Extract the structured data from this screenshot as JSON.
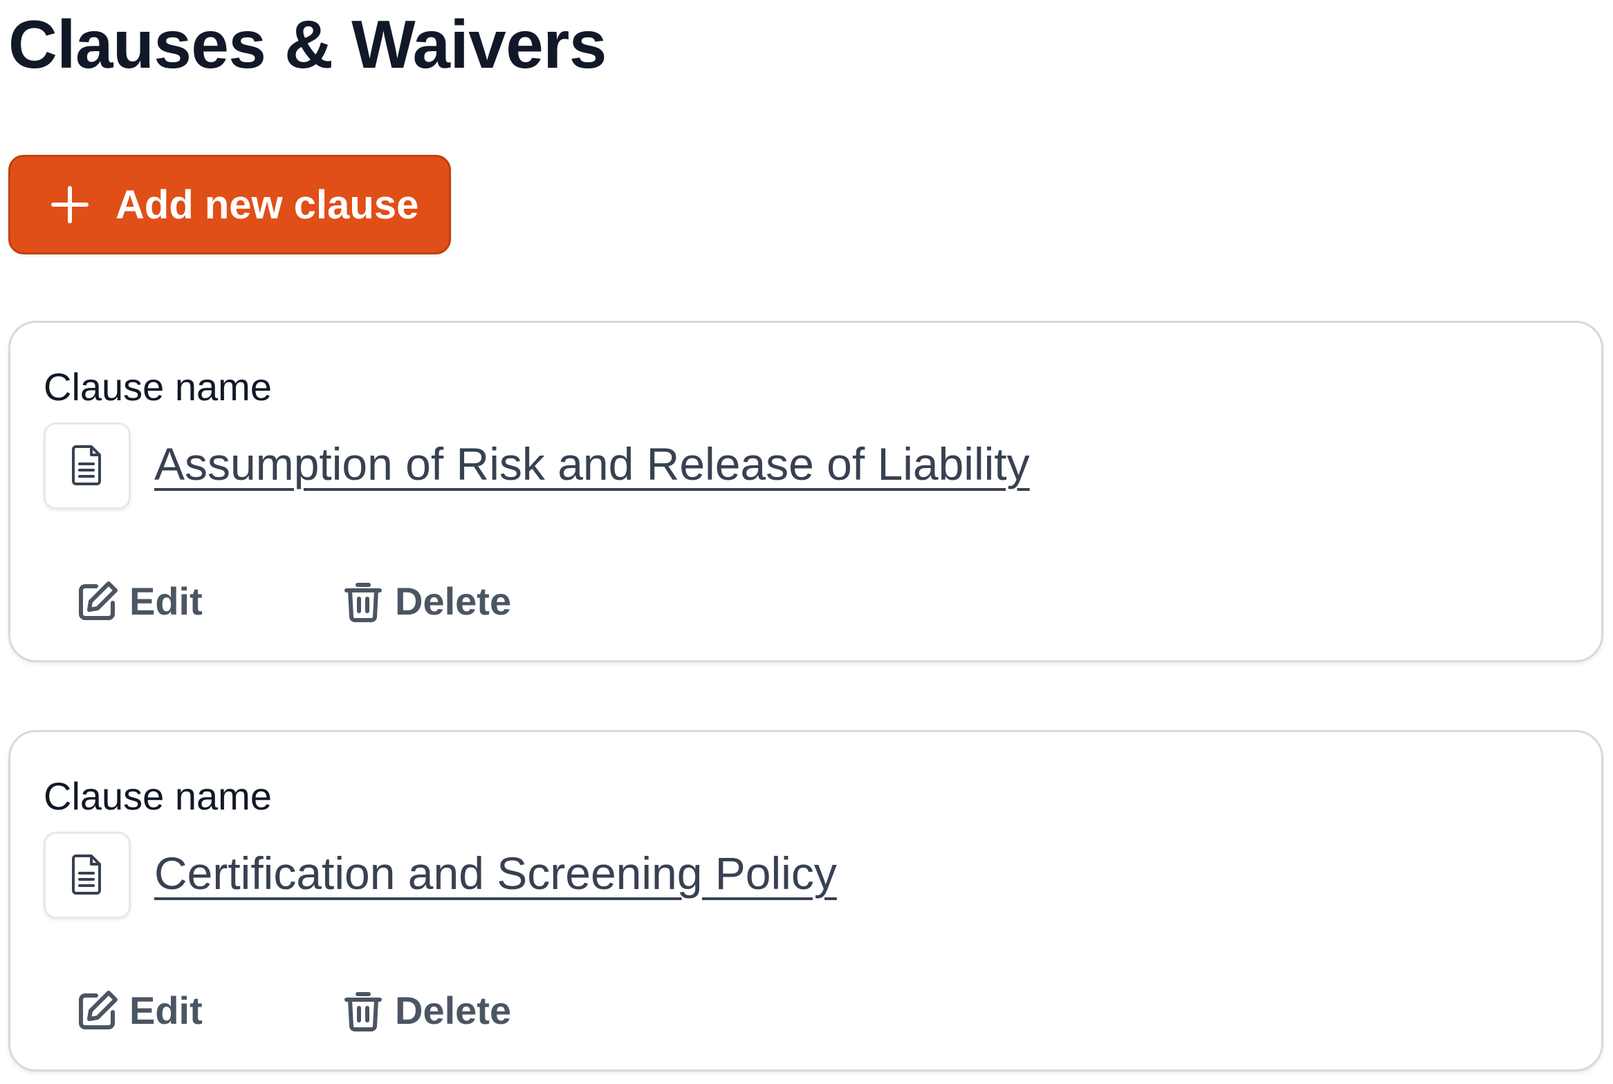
{
  "page": {
    "title": "Clauses & Waivers"
  },
  "toolbar": {
    "add_label": "Add new clause",
    "add_icon": "plus-icon",
    "accent_color": "#e04f18"
  },
  "clauses": [
    {
      "field_label": "Clause name",
      "name": "Assumption of Risk and Release of Liability",
      "icon": "document-icon",
      "edit_label": "Edit",
      "delete_label": "Delete"
    },
    {
      "field_label": "Clause name",
      "name": "Certification and Screening Policy",
      "icon": "document-icon",
      "edit_label": "Edit",
      "delete_label": "Delete"
    }
  ]
}
